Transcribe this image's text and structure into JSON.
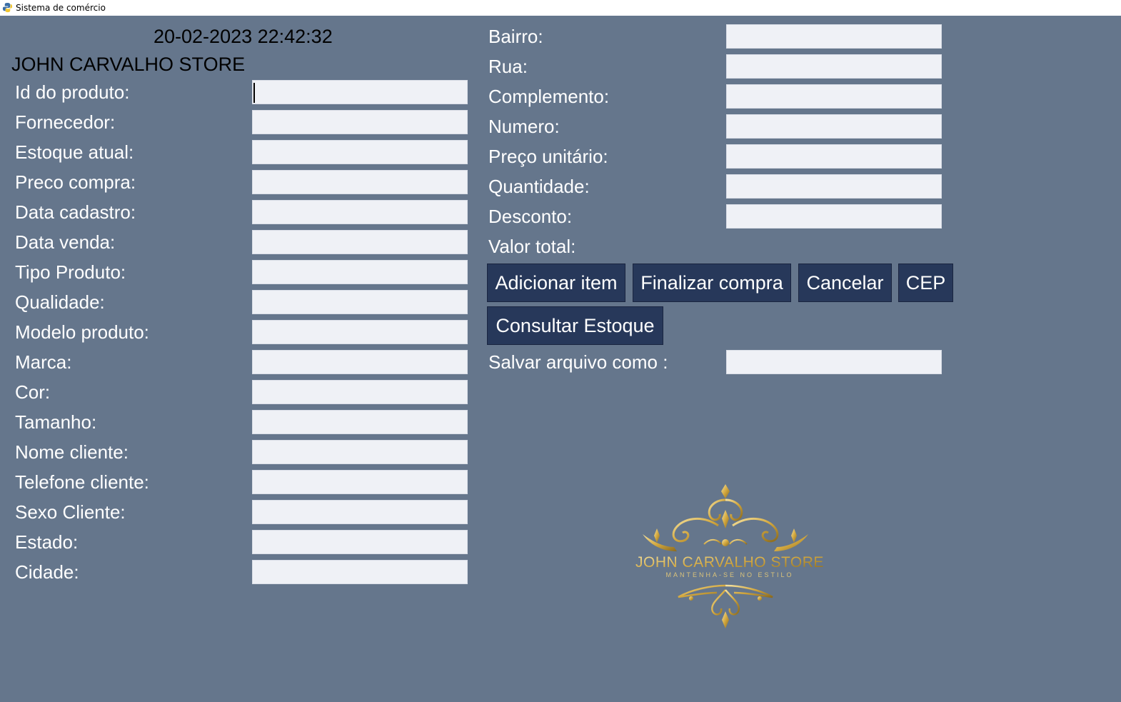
{
  "window": {
    "title": "Sistema de comércio"
  },
  "header": {
    "datetime": "20-02-2023 22:42:32",
    "store_name": "JOHN CARVALHO STORE"
  },
  "left_fields": [
    {
      "label": "Id do produto:",
      "value": ""
    },
    {
      "label": "Fornecedor:",
      "value": ""
    },
    {
      "label": "Estoque atual:",
      "value": ""
    },
    {
      "label": "Preco compra:",
      "value": ""
    },
    {
      "label": "Data cadastro:",
      "value": ""
    },
    {
      "label": "Data venda:",
      "value": ""
    },
    {
      "label": "Tipo Produto:",
      "value": ""
    },
    {
      "label": "Qualidade:",
      "value": ""
    },
    {
      "label": "Modelo produto:",
      "value": ""
    },
    {
      "label": "Marca:",
      "value": ""
    },
    {
      "label": "Cor:",
      "value": ""
    },
    {
      "label": "Tamanho:",
      "value": ""
    },
    {
      "label": "Nome cliente:",
      "value": ""
    },
    {
      "label": "Telefone cliente:",
      "value": ""
    },
    {
      "label": "Sexo Cliente:",
      "value": ""
    },
    {
      "label": "Estado:",
      "value": ""
    },
    {
      "label": "Cidade:",
      "value": ""
    }
  ],
  "right_fields": [
    {
      "label": "Bairro:",
      "value": ""
    },
    {
      "label": "Rua:",
      "value": ""
    },
    {
      "label": "Complemento:",
      "value": ""
    },
    {
      "label": "Numero:",
      "value": ""
    },
    {
      "label": "Preço unitário:",
      "value": ""
    },
    {
      "label": "Quantidade:",
      "value": ""
    },
    {
      "label": "Desconto:",
      "value": ""
    }
  ],
  "total": {
    "label": "Valor total:"
  },
  "buttons": {
    "add_item": "Adicionar item",
    "finish": "Finalizar compra",
    "cancel": "Cancelar",
    "cep": "CEP",
    "stock": "Consultar Estoque"
  },
  "save": {
    "label": "Salvar arquivo como :",
    "value": ""
  },
  "logo": {
    "name": "JOHN CARVALHO STORE",
    "tagline": "MANTENHA-SE NO ESTILO"
  },
  "colors": {
    "background": "#65768c",
    "button": "#27385a",
    "field": "#eff1f6",
    "gold": "#d4b050"
  }
}
